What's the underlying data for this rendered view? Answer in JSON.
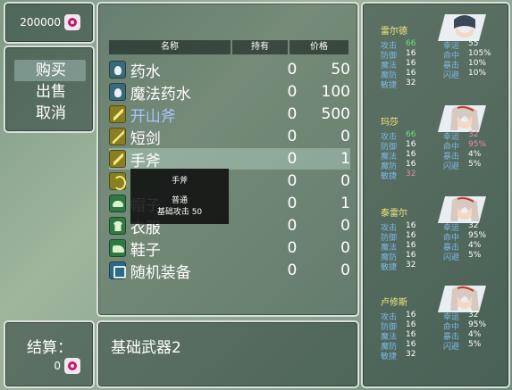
{
  "gold": {
    "amount": "200000",
    "icon": "coin-icon"
  },
  "commands": [
    {
      "label": "购买",
      "selected": true
    },
    {
      "label": "出售",
      "selected": false
    },
    {
      "label": "取消",
      "selected": false
    }
  ],
  "list": {
    "headers": {
      "name": "名称",
      "owned": "持有",
      "price": "价格"
    },
    "items": [
      {
        "icon": "potion-icon",
        "name": "药水",
        "owned": "0",
        "price": "50",
        "blue": false,
        "selected": false
      },
      {
        "icon": "potion-icon",
        "name": "魔法药水",
        "owned": "0",
        "price": "100",
        "blue": false,
        "selected": false
      },
      {
        "icon": "axe-icon",
        "name": "开山斧",
        "owned": "0",
        "price": "500",
        "blue": true,
        "selected": false
      },
      {
        "icon": "sword-icon",
        "name": "短剑",
        "owned": "0",
        "price": "0",
        "blue": false,
        "selected": false
      },
      {
        "icon": "axe-icon",
        "name": "手斧",
        "owned": "0",
        "price": "1",
        "blue": false,
        "selected": true
      },
      {
        "icon": "bow-icon",
        "name": "",
        "owned": "0",
        "price": "0",
        "blue": false,
        "selected": false
      },
      {
        "icon": "hat-icon",
        "name": "帽子",
        "owned": "0",
        "price": "1",
        "blue": false,
        "selected": false
      },
      {
        "icon": "cloth-icon",
        "name": "衣服",
        "owned": "0",
        "price": "0",
        "blue": false,
        "selected": false
      },
      {
        "icon": "shoe-icon",
        "name": "鞋子",
        "owned": "0",
        "price": "0",
        "blue": false,
        "selected": false
      },
      {
        "icon": "random-icon",
        "name": "随机装备",
        "owned": "0",
        "price": "0",
        "blue": false,
        "selected": false
      }
    ]
  },
  "tooltip": {
    "title": "手斧",
    "quality": "普通",
    "effect": "基础攻击 50"
  },
  "description": {
    "text": "基础武器2"
  },
  "settle": {
    "label": "结算：",
    "amount": "0"
  },
  "party": [
    {
      "name": "雷尔德",
      "portrait": "boy-portrait",
      "stats": [
        {
          "label": "攻击",
          "value": "66",
          "color": "green"
        },
        {
          "label": "幸运",
          "value": "55",
          "color": "white"
        },
        {
          "label": "防御",
          "value": "16",
          "color": "white"
        },
        {
          "label": "命中",
          "value": "105%",
          "color": "white"
        },
        {
          "label": "魔法",
          "value": "16",
          "color": "white"
        },
        {
          "label": "暴击",
          "value": "10%",
          "color": "white"
        },
        {
          "label": "魔防",
          "value": "16",
          "color": "white"
        },
        {
          "label": "闪避",
          "value": "10%",
          "color": "white"
        },
        {
          "label": "敏捷",
          "value": "32",
          "color": "white"
        }
      ]
    },
    {
      "name": "玛莎",
      "portrait": "girl-portrait",
      "stats": [
        {
          "label": "攻击",
          "value": "66",
          "color": "green"
        },
        {
          "label": "幸运",
          "value": "32",
          "color": "pink"
        },
        {
          "label": "防御",
          "value": "16",
          "color": "white"
        },
        {
          "label": "命中",
          "value": "95%",
          "color": "pink"
        },
        {
          "label": "魔法",
          "value": "16",
          "color": "white"
        },
        {
          "label": "暴击",
          "value": "4%",
          "color": "white"
        },
        {
          "label": "魔防",
          "value": "16",
          "color": "white"
        },
        {
          "label": "闪避",
          "value": "5%",
          "color": "white"
        },
        {
          "label": "敏捷",
          "value": "32",
          "color": "pink"
        }
      ]
    },
    {
      "name": "泰雷尔",
      "portrait": "girl-portrait",
      "stats": [
        {
          "label": "攻击",
          "value": "16",
          "color": "white"
        },
        {
          "label": "幸运",
          "value": "32",
          "color": "white"
        },
        {
          "label": "防御",
          "value": "16",
          "color": "white"
        },
        {
          "label": "命中",
          "value": "95%",
          "color": "white"
        },
        {
          "label": "魔法",
          "value": "16",
          "color": "white"
        },
        {
          "label": "暴击",
          "value": "4%",
          "color": "white"
        },
        {
          "label": "魔防",
          "value": "16",
          "color": "white"
        },
        {
          "label": "闪避",
          "value": "5%",
          "color": "white"
        },
        {
          "label": "敏捷",
          "value": "32",
          "color": "white"
        }
      ]
    },
    {
      "name": "卢修斯",
      "portrait": "girl-portrait",
      "stats": [
        {
          "label": "攻击",
          "value": "16",
          "color": "white"
        },
        {
          "label": "幸运",
          "value": "32",
          "color": "white"
        },
        {
          "label": "防御",
          "value": "16",
          "color": "white"
        },
        {
          "label": "命中",
          "value": "95%",
          "color": "white"
        },
        {
          "label": "魔法",
          "value": "16",
          "color": "white"
        },
        {
          "label": "暴击",
          "value": "4%",
          "color": "white"
        },
        {
          "label": "魔防",
          "value": "16",
          "color": "white"
        },
        {
          "label": "闪避",
          "value": "5%",
          "color": "white"
        },
        {
          "label": "敏捷",
          "value": "32",
          "color": "white"
        }
      ]
    }
  ]
}
